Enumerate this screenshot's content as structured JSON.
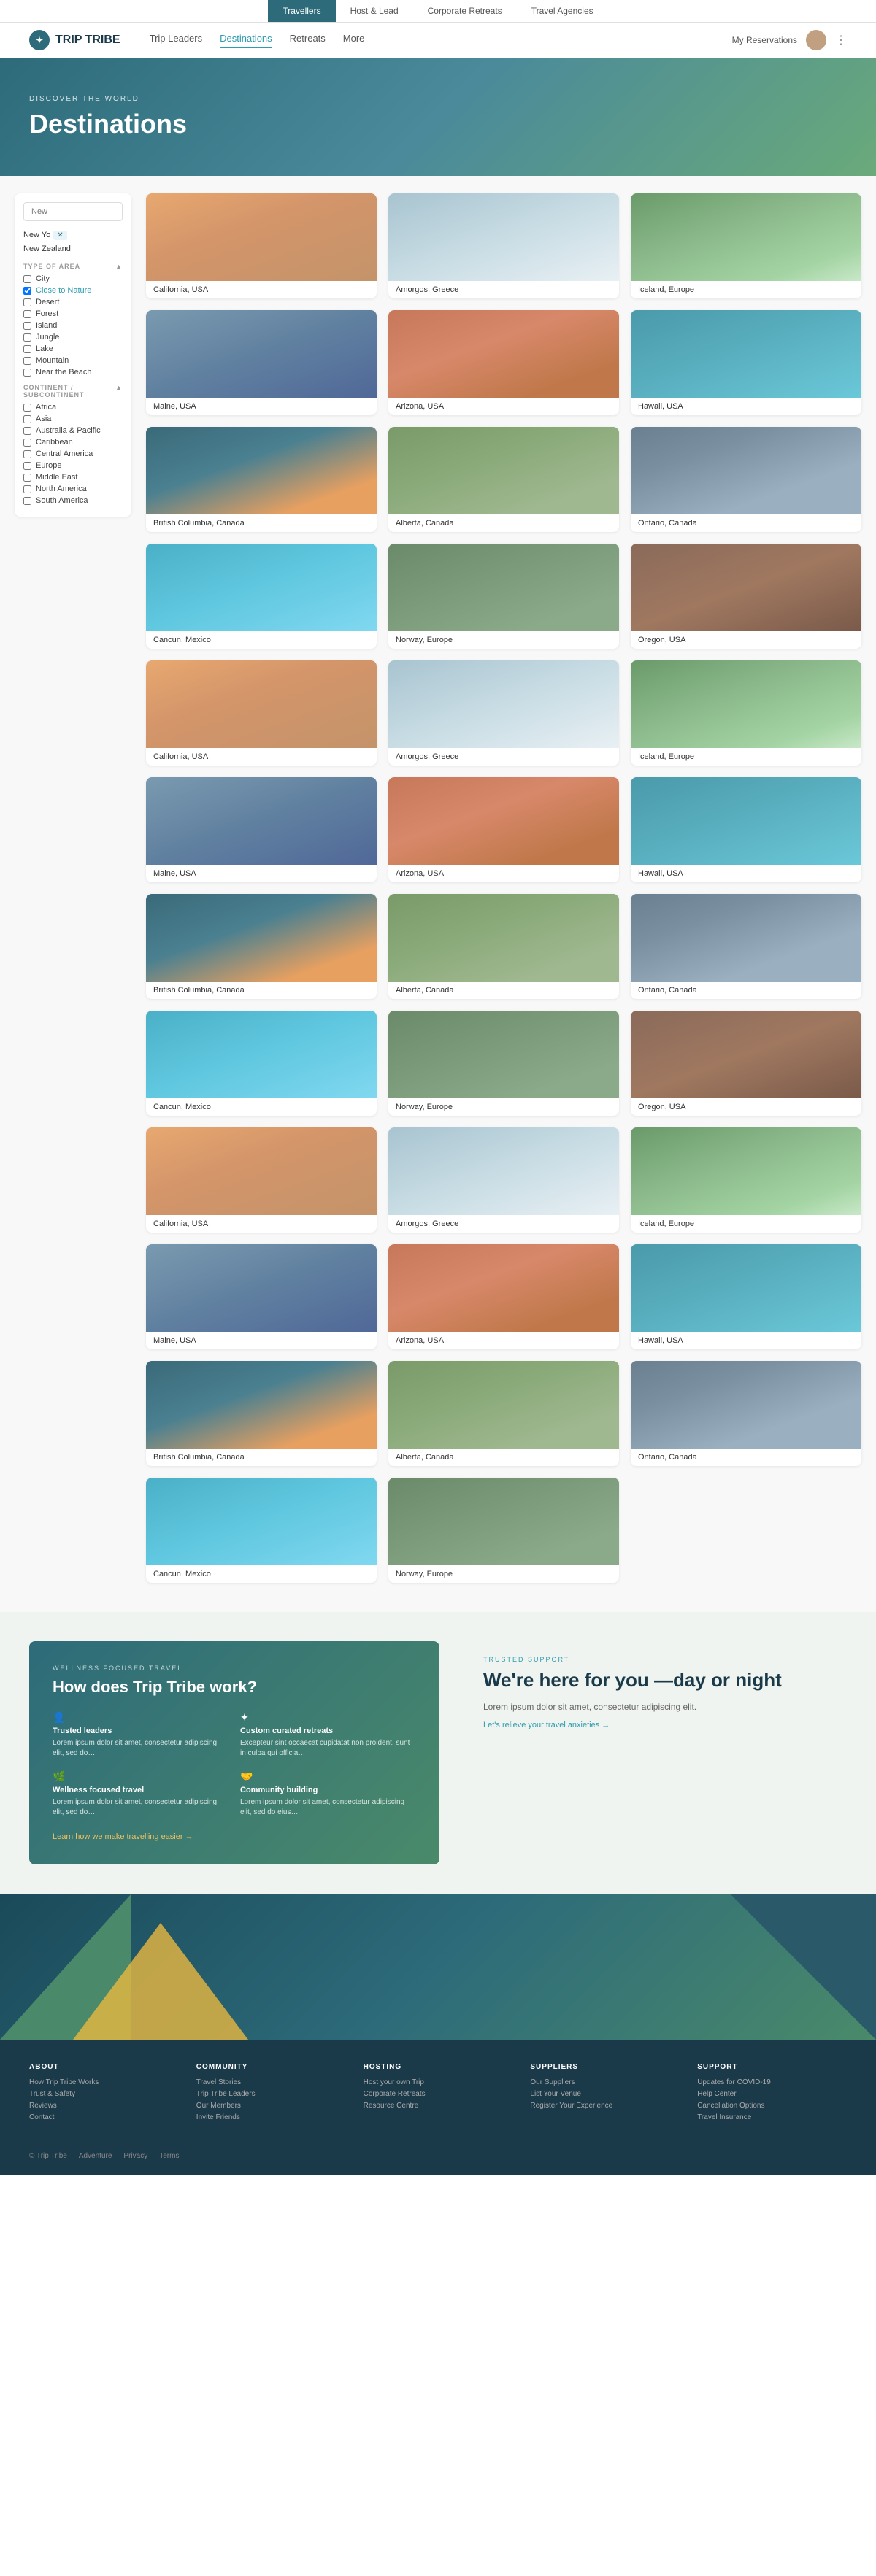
{
  "topBar": {
    "items": [
      {
        "label": "Travellers",
        "active": true
      },
      {
        "label": "Host & Lead",
        "active": false
      },
      {
        "label": "Corporate Retreats",
        "active": false
      },
      {
        "label": "Travel Agencies",
        "active": false
      }
    ]
  },
  "nav": {
    "logo": "TRIP TRIBE",
    "links": [
      {
        "label": "Trip Leaders",
        "active": false
      },
      {
        "label": "Destinations",
        "active": true
      },
      {
        "label": "Retreats",
        "active": false
      },
      {
        "label": "More",
        "active": false
      }
    ],
    "my_reservations": "My Reservations"
  },
  "hero": {
    "discover": "DISCOVER THE WORLD",
    "title": "Destinations"
  },
  "sidebar": {
    "search_placeholder": "New",
    "suggestions": [
      {
        "text": "New Yo",
        "tag": ""
      },
      {
        "text": "New Zealand",
        "tag": ""
      }
    ],
    "type_section": "TYPE OF AREA",
    "types": [
      {
        "label": "City"
      },
      {
        "label": "Close to Nature",
        "checked": true
      },
      {
        "label": "Desert"
      },
      {
        "label": "Forest"
      },
      {
        "label": "Island"
      },
      {
        "label": "Jungle"
      },
      {
        "label": "Lake"
      },
      {
        "label": "Mountain"
      },
      {
        "label": "Near the Beach"
      }
    ],
    "continent_section": "CONTINENT / SUBCONTINENT",
    "continents": [
      {
        "label": "Africa"
      },
      {
        "label": "Asia"
      },
      {
        "label": "Australia & Pacific"
      },
      {
        "label": "Caribbean"
      },
      {
        "label": "Central America"
      },
      {
        "label": "Europe"
      },
      {
        "label": "Middle East"
      },
      {
        "label": "North America"
      },
      {
        "label": "South America"
      }
    ]
  },
  "destinations": [
    [
      {
        "label": "California, USA",
        "imgClass": "img-california"
      },
      {
        "label": "Amorgos, Greece",
        "imgClass": "img-amorgos"
      },
      {
        "label": "Iceland, Europe",
        "imgClass": "img-iceland"
      }
    ],
    [
      {
        "label": "Maine, USA",
        "imgClass": "img-maine"
      },
      {
        "label": "Arizona, USA",
        "imgClass": "img-arizona"
      },
      {
        "label": "Hawaii, USA",
        "imgClass": "img-hawaii"
      }
    ],
    [
      {
        "label": "British Columbia, Canada",
        "imgClass": "img-bc"
      },
      {
        "label": "Alberta, Canada",
        "imgClass": "img-alberta"
      },
      {
        "label": "Ontario, Canada",
        "imgClass": "img-ontario"
      }
    ],
    [
      {
        "label": "Cancun, Mexico",
        "imgClass": "img-cancun"
      },
      {
        "label": "Norway, Europe",
        "imgClass": "img-norway"
      },
      {
        "label": "Oregon, USA",
        "imgClass": "img-oregon"
      }
    ],
    [
      {
        "label": "California, USA",
        "imgClass": "img-california"
      },
      {
        "label": "Amorgos, Greece",
        "imgClass": "img-amorgos"
      },
      {
        "label": "Iceland, Europe",
        "imgClass": "img-iceland"
      }
    ],
    [
      {
        "label": "Maine, USA",
        "imgClass": "img-maine"
      },
      {
        "label": "Arizona, USA",
        "imgClass": "img-arizona"
      },
      {
        "label": "Hawaii, USA",
        "imgClass": "img-hawaii"
      }
    ],
    [
      {
        "label": "British Columbia, Canada",
        "imgClass": "img-bc"
      },
      {
        "label": "Alberta, Canada",
        "imgClass": "img-alberta"
      },
      {
        "label": "Ontario, Canada",
        "imgClass": "img-ontario"
      }
    ],
    [
      {
        "label": "Cancun, Mexico",
        "imgClass": "img-cancun"
      },
      {
        "label": "Norway, Europe",
        "imgClass": "img-norway"
      },
      {
        "label": "Oregon, USA",
        "imgClass": "img-oregon"
      }
    ],
    [
      {
        "label": "California, USA",
        "imgClass": "img-california"
      },
      {
        "label": "Amorgos, Greece",
        "imgClass": "img-amorgos"
      },
      {
        "label": "Iceland, Europe",
        "imgClass": "img-iceland"
      }
    ],
    [
      {
        "label": "Maine, USA",
        "imgClass": "img-maine"
      },
      {
        "label": "Arizona, USA",
        "imgClass": "img-arizona"
      },
      {
        "label": "Hawaii, USA",
        "imgClass": "img-hawaii"
      }
    ],
    [
      {
        "label": "British Columbia, Canada",
        "imgClass": "img-bc"
      },
      {
        "label": "Alberta, Canada",
        "imgClass": "img-alberta"
      },
      {
        "label": "Ontario, Canada",
        "imgClass": "img-ontario"
      }
    ],
    [
      {
        "label": "Cancun, Mexico",
        "imgClass": "img-cancun"
      },
      {
        "label": "Norway, Europe",
        "imgClass": "img-norway"
      }
    ]
  ],
  "howSection": {
    "badge": "WELLNESS FOCUSED TRAVEL",
    "title": "How does Trip Tribe work?",
    "features": [
      {
        "icon": "👤",
        "title": "Trusted leaders",
        "desc": "Lorem ipsum dolor sit amet, consectetur adipiscing elit, sed do…"
      },
      {
        "icon": "✦",
        "title": "Custom curated retreats",
        "desc": "Excepteur sint occaecat cupidatat non proident, sunt in culpa qui officia…"
      },
      {
        "icon": "🌿",
        "title": "Wellness focused travel",
        "desc": "Lorem ipsum dolor sit amet, consectetur adipiscing elit, sed do…"
      },
      {
        "icon": "🤝",
        "title": "Community building",
        "desc": "Lorem ipsum dolor sit amet, consectetur adipiscing elit, sed do eius…"
      }
    ],
    "learn_more": "Learn how we make travelling easier →",
    "right_badge": "TRUSTED SUPPORT",
    "right_title": "We're here for you —day or night",
    "right_desc": "Lorem ipsum dolor sit amet, consectetur adipiscing elit.",
    "right_link": "Let's relieve your travel anxieties →"
  },
  "footer": {
    "about_title": "ABOUT",
    "about_items": [
      "How Trip Tribe Works",
      "Trust & Safety",
      "Reviews",
      "Contact"
    ],
    "community_title": "COMMUNITY",
    "community_items": [
      "Travel Stories",
      "Trip Tribe Leaders",
      "Our Members",
      "Invite Friends"
    ],
    "hosting_title": "HOSTING",
    "hosting_items": [
      "Host your own Trip",
      "Corporate Retreats",
      "Resource Centre"
    ],
    "suppliers_title": "SUPPLIERS",
    "suppliers_items": [
      "Our Suppliers",
      "List Your Venue",
      "Register Your Experience"
    ],
    "support_title": "SUPPORT",
    "support_items": [
      "Updates for COVID-19",
      "Help Center",
      "Cancellation Options",
      "Travel Insurance"
    ],
    "bottom": [
      "© Trip Tribe",
      "Adventure",
      "Privacy",
      "Terms"
    ]
  }
}
